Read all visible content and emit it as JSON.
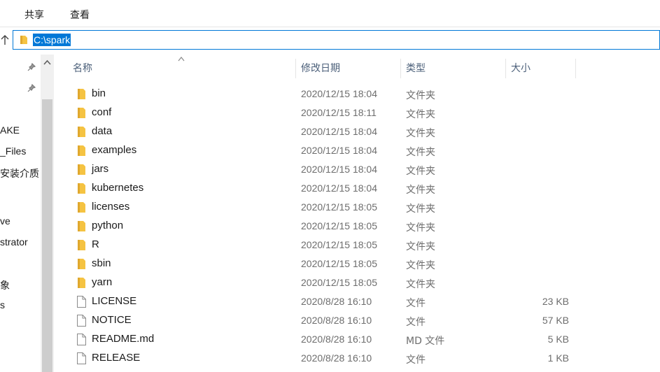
{
  "ribbon": {
    "tabs": [
      "共享",
      "查看"
    ]
  },
  "address": {
    "path": "C:\\spark"
  },
  "nav": {
    "items": [
      "AKE",
      "_Files",
      "安装介质",
      "ve",
      "strator",
      "象",
      "s"
    ]
  },
  "columns": {
    "name": "名称",
    "modified": "修改日期",
    "type": "类型",
    "size": "大小"
  },
  "files": [
    {
      "name": "bin",
      "date": "2020/12/15 18:04",
      "type": "文件夹",
      "size": "",
      "kind": "folder"
    },
    {
      "name": "conf",
      "date": "2020/12/15 18:11",
      "type": "文件夹",
      "size": "",
      "kind": "folder"
    },
    {
      "name": "data",
      "date": "2020/12/15 18:04",
      "type": "文件夹",
      "size": "",
      "kind": "folder"
    },
    {
      "name": "examples",
      "date": "2020/12/15 18:04",
      "type": "文件夹",
      "size": "",
      "kind": "folder"
    },
    {
      "name": "jars",
      "date": "2020/12/15 18:04",
      "type": "文件夹",
      "size": "",
      "kind": "folder"
    },
    {
      "name": "kubernetes",
      "date": "2020/12/15 18:04",
      "type": "文件夹",
      "size": "",
      "kind": "folder"
    },
    {
      "name": "licenses",
      "date": "2020/12/15 18:05",
      "type": "文件夹",
      "size": "",
      "kind": "folder"
    },
    {
      "name": "python",
      "date": "2020/12/15 18:05",
      "type": "文件夹",
      "size": "",
      "kind": "folder"
    },
    {
      "name": "R",
      "date": "2020/12/15 18:05",
      "type": "文件夹",
      "size": "",
      "kind": "folder"
    },
    {
      "name": "sbin",
      "date": "2020/12/15 18:05",
      "type": "文件夹",
      "size": "",
      "kind": "folder"
    },
    {
      "name": "yarn",
      "date": "2020/12/15 18:05",
      "type": "文件夹",
      "size": "",
      "kind": "folder"
    },
    {
      "name": "LICENSE",
      "date": "2020/8/28 16:10",
      "type": "文件",
      "size": "23 KB",
      "kind": "file"
    },
    {
      "name": "NOTICE",
      "date": "2020/8/28 16:10",
      "type": "文件",
      "size": "57 KB",
      "kind": "file"
    },
    {
      "name": "README.md",
      "date": "2020/8/28 16:10",
      "type": "MD 文件",
      "size": "5 KB",
      "kind": "file"
    },
    {
      "name": "RELEASE",
      "date": "2020/8/28 16:10",
      "type": "文件",
      "size": "1 KB",
      "kind": "file"
    }
  ],
  "colors": {
    "accent": "#0078d7",
    "folder": "#f5c342",
    "header_text": "#4c607a"
  }
}
